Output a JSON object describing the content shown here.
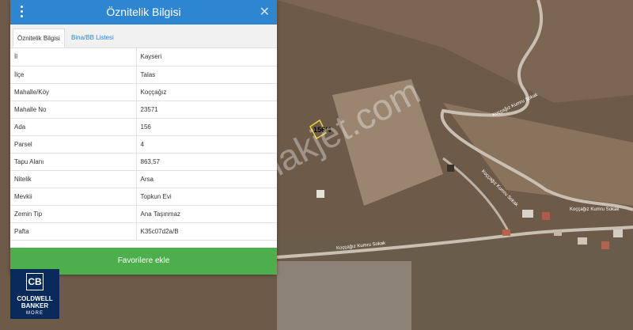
{
  "panel": {
    "title": "Öznitelik Bilgisi",
    "close": "✕",
    "tabs": [
      {
        "label": "Öznitelik Bilgisi",
        "active": true
      },
      {
        "label": "Bina/BB Listesi",
        "active": false
      }
    ],
    "rows": [
      {
        "key": "İl",
        "value": "Kayseri"
      },
      {
        "key": "İlçe",
        "value": "Talas"
      },
      {
        "key": "Mahalle/Köy",
        "value": "Koççağız"
      },
      {
        "key": "Mahalle No",
        "value": "23571"
      },
      {
        "key": "Ada",
        "value": "156"
      },
      {
        "key": "Parsel",
        "value": "4"
      },
      {
        "key": "Tapu Alanı",
        "value": "863,57"
      },
      {
        "key": "Nitelik",
        "value": "Arsa"
      },
      {
        "key": "Mevkii",
        "value": "Topkun Evi"
      },
      {
        "key": "Zemin Tip",
        "value": "Ana Taşınmaz"
      },
      {
        "key": "Pafta",
        "value": "K35c07d2a/B"
      }
    ],
    "favorite_button": "Favorilere ekle"
  },
  "map": {
    "parcel_label": "156/4",
    "watermark": "emlakjet.com",
    "road_labels": [
      "Koççağız Kumru Sokak",
      "Koççağız Kumru Sokak",
      "Koççağız Kumru Sokak",
      "Koççağız Kumru Sokak"
    ]
  },
  "logo": {
    "mark": "CB",
    "line1": "COLDWELL",
    "line2": "BANKER",
    "line3": "MORE"
  },
  "colors": {
    "header": "#2e86d1",
    "button": "#4cae4c",
    "logo_bg": "#0a2a5c",
    "parcel_outline": "#e8d23a"
  }
}
